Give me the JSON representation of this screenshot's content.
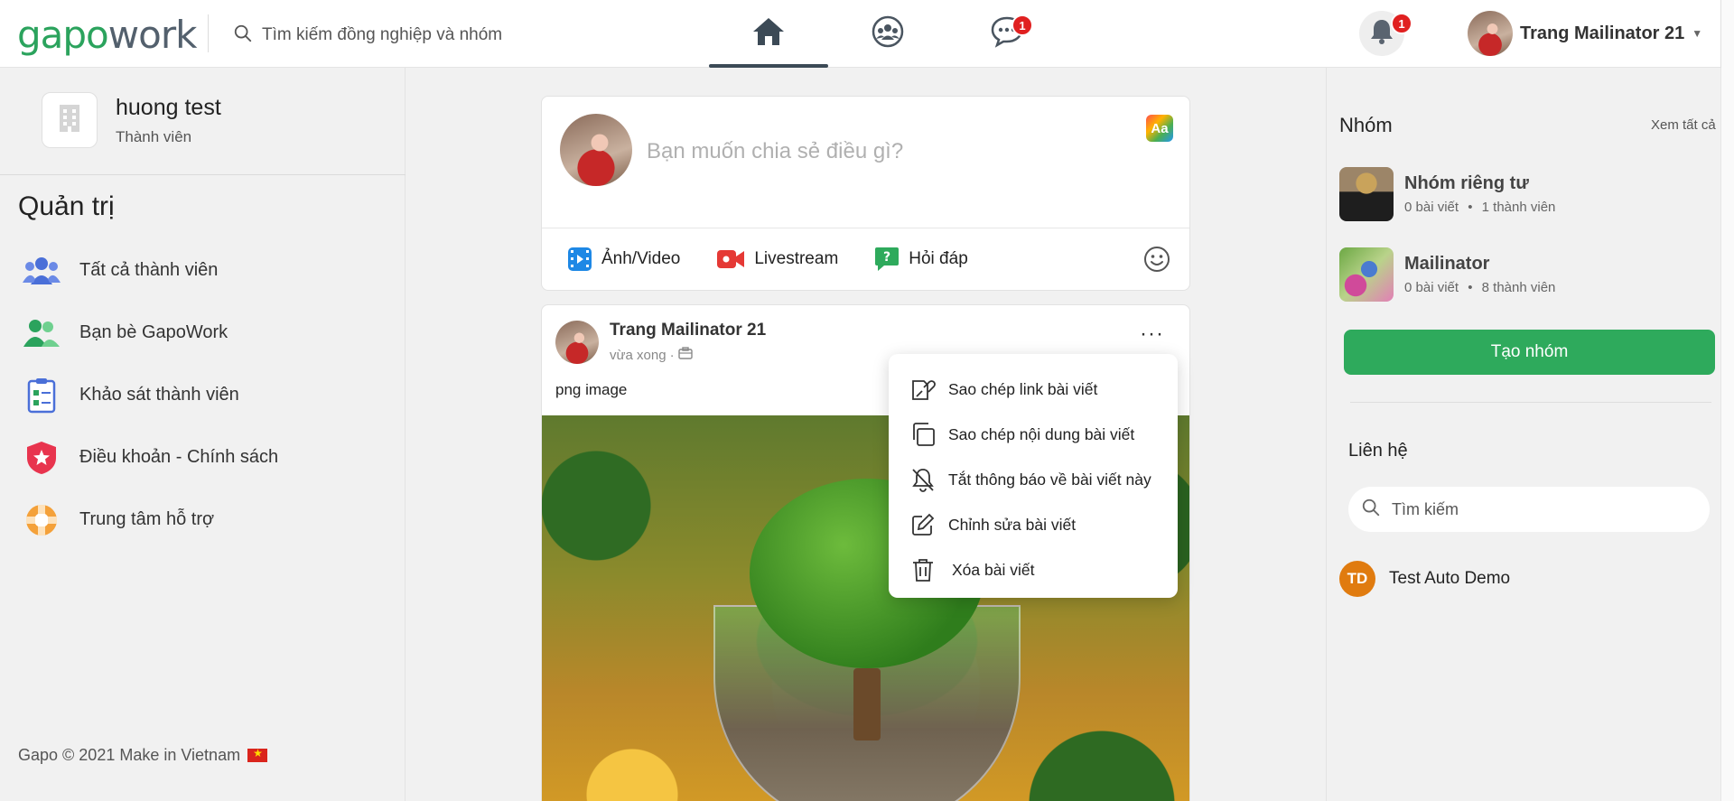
{
  "header": {
    "logo_part1": "gapo",
    "logo_part2": "work",
    "search_placeholder": "Tìm kiếm đồng nghiệp và nhóm",
    "messages_badge": "1",
    "notifications_badge": "1",
    "user_name": "Trang Mailinator 21",
    "user_caret": "▼",
    "accent_color": "#2ba35d"
  },
  "left": {
    "org_name": "huong test",
    "org_role": "Thành viên",
    "admin_title": "Quản trị",
    "menu": [
      {
        "label": "Tất cả thành viên",
        "icon": "members-icon"
      },
      {
        "label": "Bạn bè GapoWork",
        "icon": "friends-icon"
      },
      {
        "label": "Khảo sát thành viên",
        "icon": "survey-icon"
      },
      {
        "label": "Điều khoản - Chính sách",
        "icon": "policy-shield-icon"
      },
      {
        "label": "Trung tâm hỗ trợ",
        "icon": "support-lifebuoy-icon"
      }
    ],
    "footer": "Gapo © 2021 Make in Vietnam"
  },
  "composer": {
    "placeholder": "Bạn muốn chia sẻ điều gì?",
    "aa_label": "Aa",
    "actions": [
      {
        "label": "Ảnh/Video",
        "icon": "photo-video-icon"
      },
      {
        "label": "Livestream",
        "icon": "livestream-icon"
      },
      {
        "label": "Hỏi đáp",
        "icon": "qa-icon"
      }
    ]
  },
  "post": {
    "author": "Trang Mailinator 21",
    "time": "vừa xong",
    "separator": "·",
    "more": "···",
    "text": "png image"
  },
  "dropdown": {
    "items": [
      {
        "label": "Sao chép link bài viết",
        "icon": "copy-link-icon"
      },
      {
        "label": "Sao chép nội dung bài viết",
        "icon": "copy-content-icon"
      },
      {
        "label": "Tắt thông báo về bài viết này",
        "icon": "bell-off-icon"
      },
      {
        "label": "Chỉnh sửa bài viết",
        "icon": "edit-icon"
      },
      {
        "label": "Xóa bài viết",
        "icon": "trash-icon"
      }
    ]
  },
  "right": {
    "groups_title": "Nhóm",
    "see_all": "Xem tất cả",
    "groups": [
      {
        "name": "Nhóm riêng tư",
        "posts": "0 bài viết",
        "members": "1 thành viên"
      },
      {
        "name": "Mailinator",
        "posts": "0 bài viết",
        "members": "8 thành viên"
      }
    ],
    "meta_sep": "•",
    "create_group": "Tạo nhóm",
    "contacts_title": "Liên hệ",
    "contact_search_placeholder": "Tìm kiếm",
    "contacts": [
      {
        "initials": "TD",
        "name": "Test Auto Demo"
      }
    ]
  }
}
